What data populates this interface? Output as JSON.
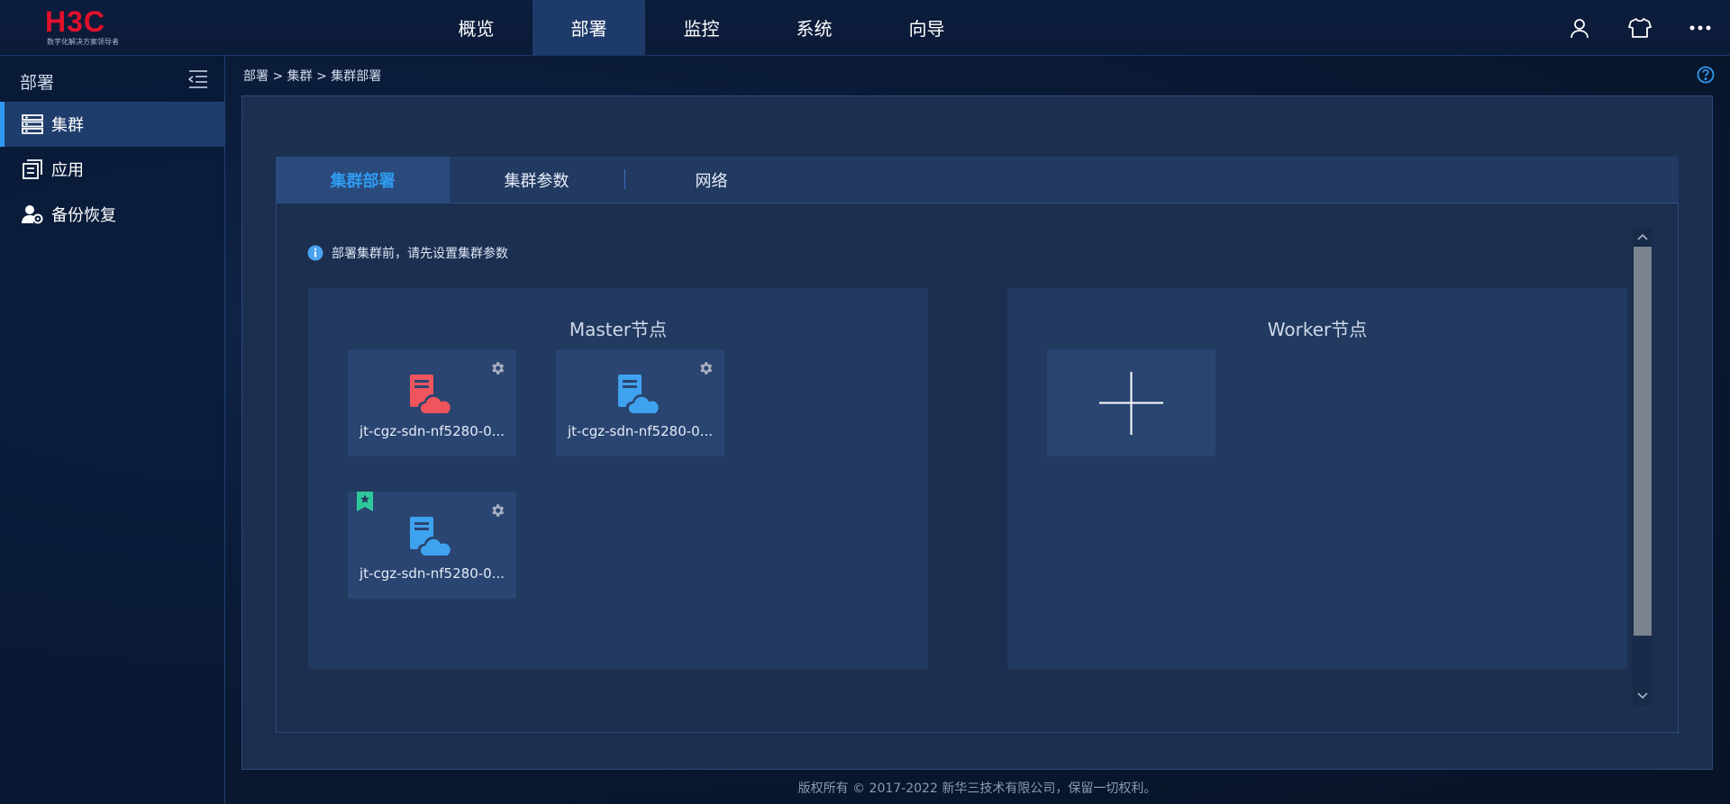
{
  "logo": {
    "text": "H3C",
    "subtitle": "数字化解决方案领导者"
  },
  "nav": {
    "items": [
      {
        "label": "概览"
      },
      {
        "label": "部署"
      },
      {
        "label": "监控"
      },
      {
        "label": "系统"
      },
      {
        "label": "向导"
      }
    ],
    "active_index": 1
  },
  "top_icons": [
    "user-icon",
    "shirt-icon",
    "more-icon"
  ],
  "sidebar": {
    "title": "部署",
    "items": [
      {
        "label": "集群",
        "icon": "server-list-icon"
      },
      {
        "label": "应用",
        "icon": "app-icon"
      },
      {
        "label": "备份恢复",
        "icon": "user-gear-icon"
      }
    ],
    "active_index": 0
  },
  "breadcrumb": "部署 > 集群 > 集群部署",
  "tabs": [
    {
      "label": "集群部署"
    },
    {
      "label": "集群参数"
    },
    {
      "label": "网络"
    }
  ],
  "active_tab": 0,
  "tip": "部署集群前，请先设置集群参数",
  "master": {
    "title": "Master节点",
    "nodes": [
      {
        "label": "jt-cgz-sdn-nf5280-0...",
        "status_color": "#f0545c"
      },
      {
        "label": "jt-cgz-sdn-nf5280-0...",
        "status_color": "#3fa2ef"
      },
      {
        "label": "jt-cgz-sdn-nf5280-0...",
        "status_color": "#3fa2ef"
      }
    ]
  },
  "worker": {
    "title": "Worker节点"
  },
  "footer": "版权所有 © 2017-2022 新华三技术有限公司，保留一切权利。",
  "colors": {
    "accent": "#2f9bf0",
    "node_red": "#f0545c",
    "node_blue": "#3fa2ef",
    "flag_green": "#2ec79a",
    "brand_red": "#e0112b"
  }
}
